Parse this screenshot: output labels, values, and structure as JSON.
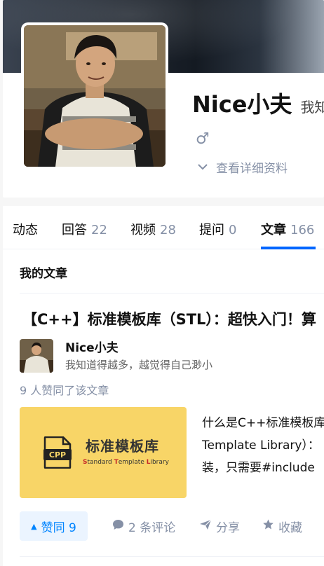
{
  "profile": {
    "name": "Nice小夫",
    "headline": "我知",
    "gender_icon": "♂",
    "detail_link": "查看详细资料"
  },
  "tabs": [
    {
      "label": "动态",
      "count": ""
    },
    {
      "label": "回答",
      "count": "22"
    },
    {
      "label": "视频",
      "count": "28"
    },
    {
      "label": "提问",
      "count": "0"
    },
    {
      "label": "文章",
      "count": "166"
    }
  ],
  "active_tab": "文章",
  "section_title": "我的文章",
  "article": {
    "title": "【C++】标准模板库（STL）：超快入门！算",
    "author_name": "Nice小夫",
    "author_bio": "我知道得越多，越觉得自己渺小",
    "likes_note": "9 人赞同了该文章",
    "thumb_badge": "CPP",
    "thumb_title": "标准模板库",
    "thumb_sub_s": "S",
    "thumb_sub_1": "tandard ",
    "thumb_sub_t": "T",
    "thumb_sub_2": "emplate ",
    "thumb_sub_l": "L",
    "thumb_sub_3": "ibrary",
    "excerpt_lines": [
      "什么是C++标准模板库",
      "Template Library）：",
      "装，只需要#include"
    ]
  },
  "actions": {
    "vote": "赞同 9",
    "comments": "2 条评论",
    "share": "分享",
    "favorite": "收藏"
  },
  "colors": {
    "accent": "#0066ff",
    "vote_bg": "#ebf4ff",
    "vote_text": "#0084ff",
    "muted": "#8590a6",
    "thumb_bg": "#f8d567"
  }
}
